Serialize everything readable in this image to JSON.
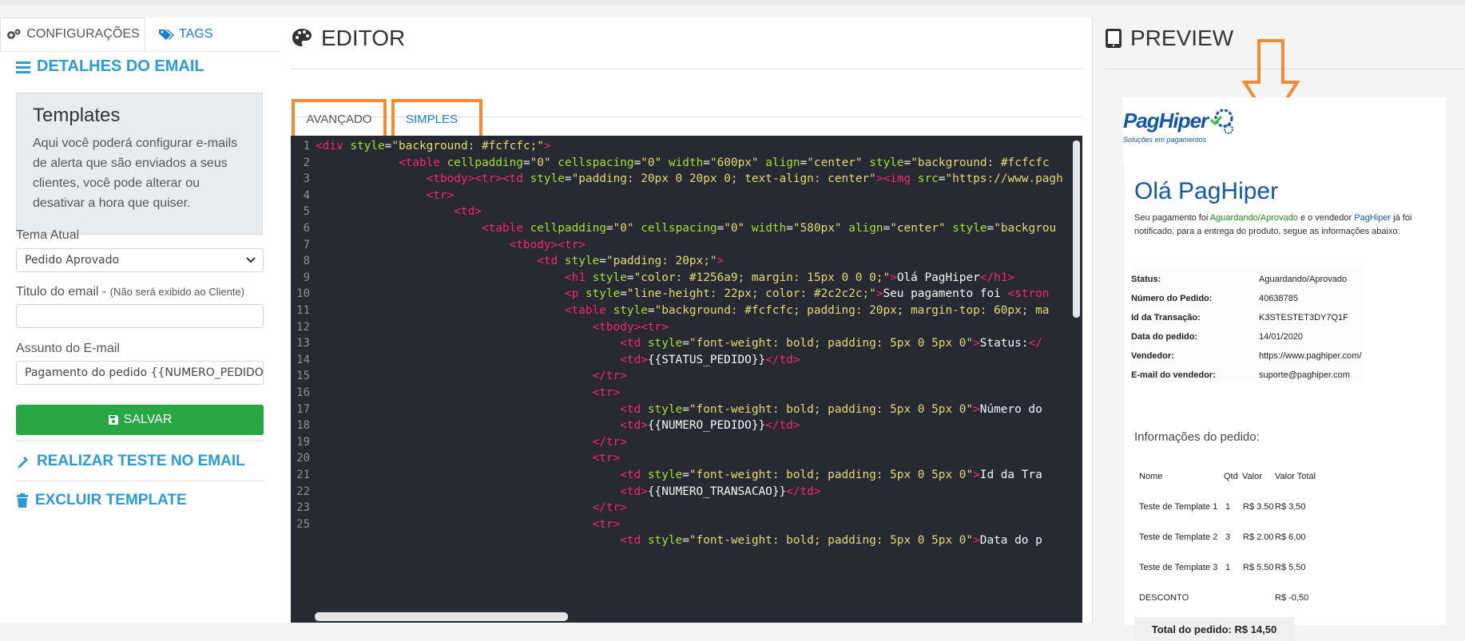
{
  "left": {
    "tabs": [
      {
        "label": "CONFIGURAÇÕES"
      },
      {
        "label": "TAGS"
      }
    ],
    "email_details_title": "DETALHES DO EMAIL",
    "templates_box": {
      "title": "Templates",
      "description": "Aqui você poderá configurar e-mails de alerta que são enviados a seus clientes, você pode alterar ou desativar a hora que quiser."
    },
    "theme": {
      "label": "Tema Atual",
      "value": "Pedido Aprovado"
    },
    "email_title": {
      "label": "Titulo do email - ",
      "hint": "(Não será exibido ao Cliente)",
      "value": ""
    },
    "subject": {
      "label": "Assunto do E-mail",
      "value": "Pagamento do pedido {{NUMERO_PEDIDO}} foi"
    },
    "save_label": "SALVAR",
    "test_label": "REALIZAR TESTE NO EMAIL",
    "delete_label": "EXCLUIR TEMPLATE",
    "colors": {
      "accent": "#2a9bd6",
      "save": "#28a745",
      "highlight": "#f68a33"
    }
  },
  "editor": {
    "title": "EDITOR",
    "tabs": [
      {
        "label": "AVANÇADO"
      },
      {
        "label": "SIMPLES"
      }
    ],
    "lines": [
      {
        "n": "1",
        "i": 0,
        "parts": [
          [
            "t",
            "<div "
          ],
          [
            "a",
            "style"
          ],
          [
            "p",
            "="
          ],
          [
            "s",
            "\"background: #fcfcfc;\""
          ],
          [
            "t",
            ">"
          ]
        ]
      },
      {
        "n": "2",
        "i": 12,
        "parts": [
          [
            "t",
            "<table "
          ],
          [
            "a",
            "cellpadding"
          ],
          [
            "p",
            "="
          ],
          [
            "s",
            "\"0\""
          ],
          [
            "p",
            " "
          ],
          [
            "a",
            "cellspacing"
          ],
          [
            "p",
            "="
          ],
          [
            "s",
            "\"0\""
          ],
          [
            "p",
            " "
          ],
          [
            "a",
            "width"
          ],
          [
            "p",
            "="
          ],
          [
            "s",
            "\"600px\""
          ],
          [
            "p",
            " "
          ],
          [
            "a",
            "align"
          ],
          [
            "p",
            "="
          ],
          [
            "s",
            "\"center\""
          ],
          [
            "p",
            " "
          ],
          [
            "a",
            "style"
          ],
          [
            "p",
            "="
          ],
          [
            "s",
            "\"background: #fcfcfc"
          ]
        ]
      },
      {
        "n": "3",
        "i": 16,
        "parts": [
          [
            "t",
            "<tbody><tr><td "
          ],
          [
            "a",
            "style"
          ],
          [
            "p",
            "="
          ],
          [
            "s",
            "\"padding: 20px 0 20px 0; text-align: center\""
          ],
          [
            "t",
            "><img "
          ],
          [
            "a",
            "src"
          ],
          [
            "p",
            "="
          ],
          [
            "s",
            "\"https://www.pagh"
          ]
        ]
      },
      {
        "n": "4",
        "i": 16,
        "parts": [
          [
            "t",
            "<tr>"
          ]
        ]
      },
      {
        "n": "5",
        "i": 20,
        "parts": [
          [
            "t",
            "<td>"
          ]
        ]
      },
      {
        "n": "6",
        "i": 24,
        "parts": [
          [
            "t",
            "<table "
          ],
          [
            "a",
            "cellpadding"
          ],
          [
            "p",
            "="
          ],
          [
            "s",
            "\"0\""
          ],
          [
            "p",
            " "
          ],
          [
            "a",
            "cellspacing"
          ],
          [
            "p",
            "="
          ],
          [
            "s",
            "\"0\""
          ],
          [
            "p",
            " "
          ],
          [
            "a",
            "width"
          ],
          [
            "p",
            "="
          ],
          [
            "s",
            "\"580px\""
          ],
          [
            "p",
            " "
          ],
          [
            "a",
            "align"
          ],
          [
            "p",
            "="
          ],
          [
            "s",
            "\"center\""
          ],
          [
            "p",
            " "
          ],
          [
            "a",
            "style"
          ],
          [
            "p",
            "="
          ],
          [
            "s",
            "\"backgrou"
          ]
        ]
      },
      {
        "n": "7",
        "i": 28,
        "parts": [
          [
            "t",
            "<tbody><tr>"
          ]
        ]
      },
      {
        "n": "8",
        "i": 32,
        "parts": [
          [
            "t",
            "<td "
          ],
          [
            "a",
            "style"
          ],
          [
            "p",
            "="
          ],
          [
            "s",
            "\"padding: 20px;\""
          ],
          [
            "t",
            ">"
          ]
        ]
      },
      {
        "n": "9",
        "i": 36,
        "parts": [
          [
            "t",
            "<h1 "
          ],
          [
            "a",
            "style"
          ],
          [
            "p",
            "="
          ],
          [
            "s",
            "\"color: #1256a9; margin: 15px 0 0 0;\""
          ],
          [
            "t",
            ">"
          ],
          [
            "p",
            "Olá PagHiper"
          ],
          [
            "t",
            "</h1>"
          ]
        ]
      },
      {
        "n": "10",
        "i": 36,
        "parts": [
          [
            "t",
            "<p "
          ],
          [
            "a",
            "style"
          ],
          [
            "p",
            "="
          ],
          [
            "s",
            "\"line-height: 22px; color: #2c2c2c;\""
          ],
          [
            "t",
            ">"
          ],
          [
            "p",
            "Seu pagamento foi "
          ],
          [
            "t",
            "<stron"
          ]
        ]
      },
      {
        "n": "11",
        "i": 36,
        "parts": [
          [
            "t",
            "<table "
          ],
          [
            "a",
            "style"
          ],
          [
            "p",
            "="
          ],
          [
            "s",
            "\"background: #fcfcfc; padding: 20px; margin-top: 60px; ma"
          ]
        ]
      },
      {
        "n": "12",
        "i": 40,
        "parts": [
          [
            "t",
            "<tbody><tr>"
          ]
        ]
      },
      {
        "n": "13",
        "i": 44,
        "parts": [
          [
            "t",
            "<td "
          ],
          [
            "a",
            "style"
          ],
          [
            "p",
            "="
          ],
          [
            "s",
            "\"font-weight: bold; padding: 5px 0 5px 0\""
          ],
          [
            "t",
            ">"
          ],
          [
            "p",
            "Status:"
          ],
          [
            "t",
            "</"
          ]
        ]
      },
      {
        "n": "14",
        "i": 44,
        "parts": [
          [
            "t",
            "<td>"
          ],
          [
            "p",
            "{{STATUS_PEDIDO}}"
          ],
          [
            "t",
            "</td>"
          ]
        ]
      },
      {
        "n": "15",
        "i": 40,
        "parts": [
          [
            "t",
            "</tr>"
          ]
        ]
      },
      {
        "n": "16",
        "i": 40,
        "parts": [
          [
            "t",
            "<tr>"
          ]
        ]
      },
      {
        "n": "17",
        "i": 44,
        "parts": [
          [
            "t",
            "<td "
          ],
          [
            "a",
            "style"
          ],
          [
            "p",
            "="
          ],
          [
            "s",
            "\"font-weight: bold; padding: 5px 0 5px 0\""
          ],
          [
            "t",
            ">"
          ],
          [
            "p",
            "Número do"
          ]
        ]
      },
      {
        "n": "18",
        "i": 44,
        "parts": [
          [
            "t",
            "<td>"
          ],
          [
            "p",
            "{{NUMERO_PEDIDO}}"
          ],
          [
            "t",
            "</td>"
          ]
        ]
      },
      {
        "n": "19",
        "i": 40,
        "parts": [
          [
            "t",
            "</tr>"
          ]
        ]
      },
      {
        "n": "20",
        "i": 40,
        "parts": [
          [
            "t",
            "<tr>"
          ]
        ]
      },
      {
        "n": "21",
        "i": 44,
        "parts": [
          [
            "t",
            "<td "
          ],
          [
            "a",
            "style"
          ],
          [
            "p",
            "="
          ],
          [
            "s",
            "\"font-weight: bold; padding: 5px 0 5px 0\""
          ],
          [
            "t",
            ">"
          ],
          [
            "p",
            "Id da Tra"
          ]
        ]
      },
      {
        "n": "22",
        "i": 44,
        "parts": [
          [
            "t",
            "<td>"
          ],
          [
            "p",
            "{{NUMERO_TRANSACAO}}"
          ],
          [
            "t",
            "</td>"
          ]
        ]
      },
      {
        "n": "23",
        "i": 40,
        "parts": [
          [
            "t",
            "</tr>"
          ]
        ]
      },
      {
        "n": "25",
        "i": 40,
        "parts": [
          [
            "t",
            "<tr>"
          ]
        ]
      },
      {
        "n": "",
        "i": 44,
        "parts": [
          [
            "t",
            "<td "
          ],
          [
            "a",
            "style"
          ],
          [
            "p",
            "="
          ],
          [
            "s",
            "\"font-weight: bold; padding: 5px 0 5px 0\""
          ],
          [
            "t",
            ">"
          ],
          [
            "p",
            "Data do p"
          ]
        ]
      }
    ]
  },
  "preview": {
    "title": "PREVIEW",
    "logo_text": "PagHiper",
    "logo_tagline": "Soluções em pagamentos",
    "greeting": "Olá PagHiper",
    "intro_1": "Seu pagamento foi ",
    "intro_status": "Aguardando/Aprovado",
    "intro_2": " e o vendedor ",
    "intro_seller": "PagHiper",
    "intro_3": " já foi notificado, para a entrega do produto, segue as informações abaixo:",
    "status_rows": [
      {
        "k": "Status:",
        "v": "Aguardando/Aprovado"
      },
      {
        "k": "Número do Pedido:",
        "v": "40638785"
      },
      {
        "k": "Id da Transação:",
        "v": "K3STESTET3DY7Q1F"
      },
      {
        "k": "Data do pedido:",
        "v": "14/01/2020"
      },
      {
        "k": "Vendedor:",
        "v": "https://www.paghiper.com/"
      },
      {
        "k": "E-mail do vendedor:",
        "v": "suporte@paghiper.com"
      }
    ],
    "order_title": "Informações do pedido:",
    "order_header": {
      "name": "Nome",
      "qty": "Qtd",
      "value": "Valor",
      "total": "Valor Total"
    },
    "order_rows": [
      {
        "name": "Teste de Template 1",
        "qty": "1",
        "value": "R$ 3.50",
        "total": "R$ 3,50"
      },
      {
        "name": "Teste de Template 2",
        "qty": "3",
        "value": "R$ 2.00",
        "total": "R$ 6,00"
      },
      {
        "name": "Teste de Template 3",
        "qty": "1",
        "value": "R$ 5.50",
        "total": "R$ 5,50"
      }
    ],
    "discount": {
      "name": "DESCONTO",
      "total": "R$ -0,50"
    },
    "total": "Total do pedido: R$ 14,50"
  }
}
